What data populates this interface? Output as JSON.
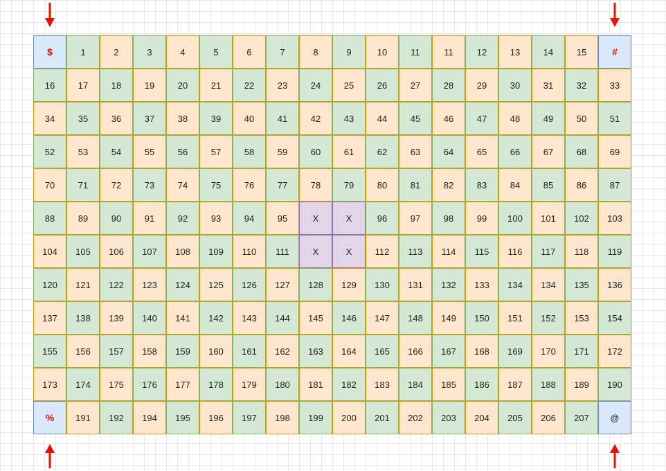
{
  "colors": {
    "orange": "#ffe6cc",
    "green": "#d5e8d4",
    "blue": "#dae8fc",
    "purple": "#e1d5e7",
    "arrow": "#e51400"
  },
  "arrows": [
    {
      "name": "arrow-down-top-left-icon",
      "direction": "down"
    },
    {
      "name": "arrow-down-top-right-icon",
      "direction": "down"
    },
    {
      "name": "arrow-up-bottom-left-icon",
      "direction": "up"
    },
    {
      "name": "arrow-up-bottom-right-icon",
      "direction": "up"
    }
  ],
  "grid": {
    "rows": [
      [
        {
          "t": "$",
          "c": "blue",
          "r": 1
        },
        {
          "t": "1",
          "c": "green"
        },
        {
          "t": "2",
          "c": "orange"
        },
        {
          "t": "3",
          "c": "green"
        },
        {
          "t": "4",
          "c": "orange"
        },
        {
          "t": "5",
          "c": "green"
        },
        {
          "t": "6",
          "c": "orange"
        },
        {
          "t": "7",
          "c": "green"
        },
        {
          "t": "8",
          "c": "orange"
        },
        {
          "t": "9",
          "c": "green"
        },
        {
          "t": "10",
          "c": "orange"
        },
        {
          "t": "11",
          "c": "green"
        },
        {
          "t": "11",
          "c": "orange"
        },
        {
          "t": "12",
          "c": "green"
        },
        {
          "t": "13",
          "c": "orange"
        },
        {
          "t": "14",
          "c": "green"
        },
        {
          "t": "15",
          "c": "orange"
        },
        {
          "t": "#",
          "c": "blue",
          "r": 1
        }
      ],
      [
        {
          "t": "16",
          "c": "green"
        },
        {
          "t": "17",
          "c": "orange"
        },
        {
          "t": "18",
          "c": "green"
        },
        {
          "t": "19",
          "c": "orange"
        },
        {
          "t": "20",
          "c": "green"
        },
        {
          "t": "21",
          "c": "orange"
        },
        {
          "t": "22",
          "c": "green"
        },
        {
          "t": "23",
          "c": "orange"
        },
        {
          "t": "24",
          "c": "green"
        },
        {
          "t": "25",
          "c": "orange"
        },
        {
          "t": "26",
          "c": "green"
        },
        {
          "t": "27",
          "c": "orange"
        },
        {
          "t": "28",
          "c": "green"
        },
        {
          "t": "29",
          "c": "orange"
        },
        {
          "t": "30",
          "c": "green"
        },
        {
          "t": "31",
          "c": "orange"
        },
        {
          "t": "32",
          "c": "green"
        },
        {
          "t": "33",
          "c": "orange"
        }
      ],
      [
        {
          "t": "34",
          "c": "orange"
        },
        {
          "t": "35",
          "c": "green"
        },
        {
          "t": "36",
          "c": "orange"
        },
        {
          "t": "37",
          "c": "green"
        },
        {
          "t": "38",
          "c": "orange"
        },
        {
          "t": "39",
          "c": "green"
        },
        {
          "t": "40",
          "c": "orange"
        },
        {
          "t": "41",
          "c": "green"
        },
        {
          "t": "42",
          "c": "orange"
        },
        {
          "t": "43",
          "c": "green"
        },
        {
          "t": "44",
          "c": "orange"
        },
        {
          "t": "45",
          "c": "green"
        },
        {
          "t": "46",
          "c": "orange"
        },
        {
          "t": "47",
          "c": "green"
        },
        {
          "t": "48",
          "c": "orange"
        },
        {
          "t": "49",
          "c": "green"
        },
        {
          "t": "50",
          "c": "orange"
        },
        {
          "t": "51",
          "c": "green"
        }
      ],
      [
        {
          "t": "52",
          "c": "green"
        },
        {
          "t": "53",
          "c": "orange"
        },
        {
          "t": "54",
          "c": "green"
        },
        {
          "t": "55",
          "c": "orange"
        },
        {
          "t": "56",
          "c": "green"
        },
        {
          "t": "57",
          "c": "orange"
        },
        {
          "t": "58",
          "c": "green"
        },
        {
          "t": "59",
          "c": "orange"
        },
        {
          "t": "60",
          "c": "green"
        },
        {
          "t": "61",
          "c": "orange"
        },
        {
          "t": "62",
          "c": "green"
        },
        {
          "t": "63",
          "c": "orange"
        },
        {
          "t": "64",
          "c": "green"
        },
        {
          "t": "65",
          "c": "orange"
        },
        {
          "t": "66",
          "c": "green"
        },
        {
          "t": "67",
          "c": "orange"
        },
        {
          "t": "68",
          "c": "green"
        },
        {
          "t": "69",
          "c": "orange"
        }
      ],
      [
        {
          "t": "70",
          "c": "orange"
        },
        {
          "t": "71",
          "c": "green"
        },
        {
          "t": "72",
          "c": "orange"
        },
        {
          "t": "73",
          "c": "green"
        },
        {
          "t": "74",
          "c": "orange"
        },
        {
          "t": "75",
          "c": "green"
        },
        {
          "t": "76",
          "c": "orange"
        },
        {
          "t": "77",
          "c": "green"
        },
        {
          "t": "78",
          "c": "orange"
        },
        {
          "t": "79",
          "c": "green"
        },
        {
          "t": "80",
          "c": "orange"
        },
        {
          "t": "81",
          "c": "green"
        },
        {
          "t": "82",
          "c": "orange"
        },
        {
          "t": "83",
          "c": "green"
        },
        {
          "t": "84",
          "c": "orange"
        },
        {
          "t": "85",
          "c": "green"
        },
        {
          "t": "86",
          "c": "orange"
        },
        {
          "t": "87",
          "c": "green"
        }
      ],
      [
        {
          "t": "88",
          "c": "green"
        },
        {
          "t": "89",
          "c": "orange"
        },
        {
          "t": "90",
          "c": "green"
        },
        {
          "t": "91",
          "c": "orange"
        },
        {
          "t": "92",
          "c": "green"
        },
        {
          "t": "93",
          "c": "orange"
        },
        {
          "t": "94",
          "c": "green"
        },
        {
          "t": "95",
          "c": "orange"
        },
        {
          "t": "X",
          "c": "purple"
        },
        {
          "t": "X",
          "c": "purple"
        },
        {
          "t": "96",
          "c": "green"
        },
        {
          "t": "97",
          "c": "orange"
        },
        {
          "t": "98",
          "c": "green"
        },
        {
          "t": "99",
          "c": "orange"
        },
        {
          "t": "100",
          "c": "green"
        },
        {
          "t": "101",
          "c": "orange"
        },
        {
          "t": "102",
          "c": "green"
        },
        {
          "t": "103",
          "c": "orange"
        }
      ],
      [
        {
          "t": "104",
          "c": "orange"
        },
        {
          "t": "105",
          "c": "green"
        },
        {
          "t": "106",
          "c": "orange"
        },
        {
          "t": "107",
          "c": "green"
        },
        {
          "t": "108",
          "c": "orange"
        },
        {
          "t": "109",
          "c": "green"
        },
        {
          "t": "110",
          "c": "orange"
        },
        {
          "t": "111",
          "c": "green"
        },
        {
          "t": "X",
          "c": "purple"
        },
        {
          "t": "X",
          "c": "purple"
        },
        {
          "t": "112",
          "c": "orange"
        },
        {
          "t": "113",
          "c": "green"
        },
        {
          "t": "114",
          "c": "orange"
        },
        {
          "t": "115",
          "c": "green"
        },
        {
          "t": "116",
          "c": "orange"
        },
        {
          "t": "117",
          "c": "green"
        },
        {
          "t": "118",
          "c": "orange"
        },
        {
          "t": "119",
          "c": "green"
        }
      ],
      [
        {
          "t": "120",
          "c": "green"
        },
        {
          "t": "121",
          "c": "orange"
        },
        {
          "t": "122",
          "c": "green"
        },
        {
          "t": "123",
          "c": "orange"
        },
        {
          "t": "124",
          "c": "green"
        },
        {
          "t": "125",
          "c": "orange"
        },
        {
          "t": "126",
          "c": "green"
        },
        {
          "t": "127",
          "c": "orange"
        },
        {
          "t": "128",
          "c": "green"
        },
        {
          "t": "129",
          "c": "orange"
        },
        {
          "t": "130",
          "c": "green"
        },
        {
          "t": "131",
          "c": "orange"
        },
        {
          "t": "132",
          "c": "green"
        },
        {
          "t": "133",
          "c": "orange"
        },
        {
          "t": "134",
          "c": "green"
        },
        {
          "t": "134",
          "c": "orange"
        },
        {
          "t": "135",
          "c": "green"
        },
        {
          "t": "136",
          "c": "orange"
        }
      ],
      [
        {
          "t": "137",
          "c": "orange"
        },
        {
          "t": "138",
          "c": "green"
        },
        {
          "t": "139",
          "c": "orange"
        },
        {
          "t": "140",
          "c": "green"
        },
        {
          "t": "141",
          "c": "orange"
        },
        {
          "t": "142",
          "c": "green"
        },
        {
          "t": "143",
          "c": "orange"
        },
        {
          "t": "144",
          "c": "green"
        },
        {
          "t": "145",
          "c": "orange"
        },
        {
          "t": "146",
          "c": "green"
        },
        {
          "t": "147",
          "c": "orange"
        },
        {
          "t": "148",
          "c": "green"
        },
        {
          "t": "149",
          "c": "orange"
        },
        {
          "t": "150",
          "c": "green"
        },
        {
          "t": "151",
          "c": "orange"
        },
        {
          "t": "152",
          "c": "green"
        },
        {
          "t": "153",
          "c": "orange"
        },
        {
          "t": "154",
          "c": "green"
        }
      ],
      [
        {
          "t": "155",
          "c": "green"
        },
        {
          "t": "156",
          "c": "orange"
        },
        {
          "t": "157",
          "c": "green"
        },
        {
          "t": "158",
          "c": "orange"
        },
        {
          "t": "159",
          "c": "green"
        },
        {
          "t": "160",
          "c": "orange"
        },
        {
          "t": "161",
          "c": "green"
        },
        {
          "t": "162",
          "c": "orange"
        },
        {
          "t": "163",
          "c": "green"
        },
        {
          "t": "164",
          "c": "orange"
        },
        {
          "t": "165",
          "c": "green"
        },
        {
          "t": "166",
          "c": "orange"
        },
        {
          "t": "167",
          "c": "green"
        },
        {
          "t": "168",
          "c": "orange"
        },
        {
          "t": "169",
          "c": "green"
        },
        {
          "t": "170",
          "c": "orange"
        },
        {
          "t": "171",
          "c": "green"
        },
        {
          "t": "172",
          "c": "orange"
        }
      ],
      [
        {
          "t": "173",
          "c": "orange"
        },
        {
          "t": "174",
          "c": "green"
        },
        {
          "t": "175",
          "c": "orange"
        },
        {
          "t": "176",
          "c": "green"
        },
        {
          "t": "177",
          "c": "orange"
        },
        {
          "t": "178",
          "c": "green"
        },
        {
          "t": "179",
          "c": "orange"
        },
        {
          "t": "180",
          "c": "green"
        },
        {
          "t": "181",
          "c": "orange"
        },
        {
          "t": "182",
          "c": "green"
        },
        {
          "t": "183",
          "c": "orange"
        },
        {
          "t": "184",
          "c": "green"
        },
        {
          "t": "185",
          "c": "orange"
        },
        {
          "t": "186",
          "c": "green"
        },
        {
          "t": "187",
          "c": "orange"
        },
        {
          "t": "188",
          "c": "green"
        },
        {
          "t": "189",
          "c": "orange"
        },
        {
          "t": "190",
          "c": "green"
        }
      ],
      [
        {
          "t": "%",
          "c": "blue",
          "r": 1
        },
        {
          "t": "191",
          "c": "orange"
        },
        {
          "t": "192",
          "c": "green"
        },
        {
          "t": "194",
          "c": "orange"
        },
        {
          "t": "195",
          "c": "green"
        },
        {
          "t": "196",
          "c": "orange"
        },
        {
          "t": "197",
          "c": "green"
        },
        {
          "t": "198",
          "c": "orange"
        },
        {
          "t": "199",
          "c": "green"
        },
        {
          "t": "200",
          "c": "orange"
        },
        {
          "t": "201",
          "c": "green"
        },
        {
          "t": "202",
          "c": "orange"
        },
        {
          "t": "203",
          "c": "green"
        },
        {
          "t": "204",
          "c": "orange"
        },
        {
          "t": "205",
          "c": "green"
        },
        {
          "t": "206",
          "c": "orange"
        },
        {
          "t": "207",
          "c": "green"
        },
        {
          "t": "@",
          "c": "blue"
        }
      ]
    ]
  }
}
